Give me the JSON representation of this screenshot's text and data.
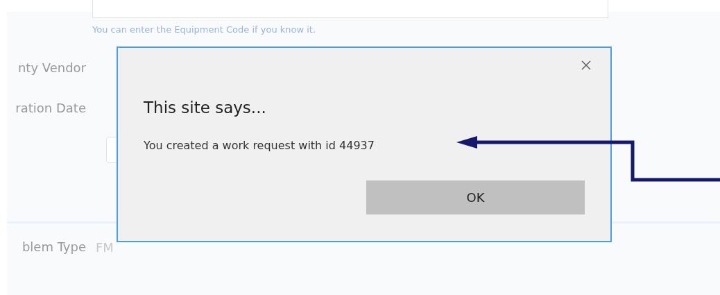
{
  "help_text": "You can enter the Equipment Code if you know it.",
  "fields": [
    {
      "label": "nty Vendor"
    },
    {
      "label": "ration Date"
    }
  ],
  "problem_type": {
    "label": "blem Type",
    "value": "FM"
  },
  "dialog": {
    "title": "This site says...",
    "message": "You created a work request with id 44937",
    "button": "OK"
  }
}
